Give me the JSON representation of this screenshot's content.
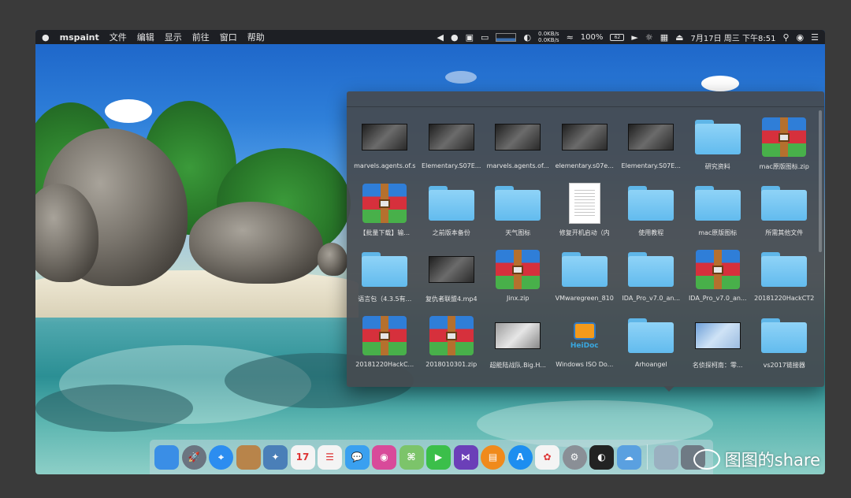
{
  "menubar": {
    "app_name": "mspaint",
    "menus": [
      "文件",
      "编辑",
      "显示",
      "前往",
      "窗口",
      "帮助"
    ],
    "net_up": "0.0KB/s",
    "net_down": "0.0KB/s",
    "battery_percent": "100%",
    "battery_icon_text": "62",
    "datetime": "7月17日 周三 下午8:51",
    "status_icons": [
      "back-icon",
      "qq-icon",
      "screenshot-icon",
      "cast-icon",
      "cpu-graph-icon",
      "moon-icon",
      "wifi-icon",
      "battery-icon",
      "volume-icon",
      "brightness-icon",
      "input-method-icon",
      "eject-icon",
      "search-icon",
      "siri-icon",
      "notification-center-icon"
    ]
  },
  "stack": {
    "items": [
      {
        "label": "marvels.agents.of.s",
        "kind": "video"
      },
      {
        "label": "Elementary.S07E...",
        "kind": "video"
      },
      {
        "label": "marvels.agents.of...",
        "kind": "video"
      },
      {
        "label": "elementary.s07e...",
        "kind": "video"
      },
      {
        "label": "Elementary.S07E...",
        "kind": "video"
      },
      {
        "label": "研究资料",
        "kind": "folder"
      },
      {
        "label": "mac原版图标.zip",
        "kind": "rar"
      },
      {
        "label": "【批量下载】输...",
        "kind": "rar"
      },
      {
        "label": "之前版本备份",
        "kind": "folder"
      },
      {
        "label": "天气图标",
        "kind": "folder"
      },
      {
        "label": "修复开机启动（内",
        "kind": "doc"
      },
      {
        "label": "使用教程",
        "kind": "folder"
      },
      {
        "label": "mac原版图标",
        "kind": "folder"
      },
      {
        "label": "所需其他文件",
        "kind": "folder"
      },
      {
        "label": "语言包（4.3.5有...",
        "kind": "folder"
      },
      {
        "label": "复仇者联盟4.mp4",
        "kind": "video"
      },
      {
        "label": "Jinx.zip",
        "kind": "rar"
      },
      {
        "label": "VMwaregreen_810",
        "kind": "folder"
      },
      {
        "label": "IDA_Pro_v7.0_an...",
        "kind": "folder"
      },
      {
        "label": "IDA_Pro_v7.0_an...",
        "kind": "rar"
      },
      {
        "label": "20181220HackCT2",
        "kind": "folder"
      },
      {
        "label": "20181220HackC...",
        "kind": "rar"
      },
      {
        "label": "2018010301.zip",
        "kind": "rar"
      },
      {
        "label": "超能陆战队.Big.H...",
        "kind": "video-light"
      },
      {
        "label": "Windows ISO Do...",
        "kind": "heidoc"
      },
      {
        "label": "Arhoangel",
        "kind": "folder"
      },
      {
        "label": "名侦探柯南：零...",
        "kind": "video-sky"
      },
      {
        "label": "vs2017链接器",
        "kind": "folder"
      }
    ],
    "heidoc_text": "HeiDoc"
  },
  "dock": {
    "apps": [
      {
        "name": "finder-icon",
        "color": "#3a8ee6",
        "glyph": ""
      },
      {
        "name": "launchpad-icon",
        "color": "#6b7480",
        "glyph": "🚀"
      },
      {
        "name": "safari-icon",
        "color": "#2c8df0",
        "glyph": "⌖"
      },
      {
        "name": "notes-book-icon",
        "color": "#b8844a",
        "glyph": ""
      },
      {
        "name": "preview-icon",
        "color": "#4a7fb8",
        "glyph": "✦"
      },
      {
        "name": "calendar-icon",
        "color": "#f4f4f4",
        "glyph": "17"
      },
      {
        "name": "reminders-icon",
        "color": "#f4f4f4",
        "glyph": "☰"
      },
      {
        "name": "messages-icon",
        "color": "#3aa0f0",
        "glyph": "💬"
      },
      {
        "name": "photo-booth-icon",
        "color": "#d84a9a",
        "glyph": "◉"
      },
      {
        "name": "maps-icon",
        "color": "#7cc46a",
        "glyph": "⌘"
      },
      {
        "name": "facetime-icon",
        "color": "#3bbf4a",
        "glyph": "▶"
      },
      {
        "name": "visual-studio-icon",
        "color": "#6b3fb8",
        "glyph": "⋈"
      },
      {
        "name": "books-icon",
        "color": "#f08a1c",
        "glyph": "▤"
      },
      {
        "name": "app-store-icon",
        "color": "#1d8ef0",
        "glyph": "A"
      },
      {
        "name": "photos-icon",
        "color": "#f4f4f4",
        "glyph": "✿"
      },
      {
        "name": "system-preferences-icon",
        "color": "#8a8f96",
        "glyph": "⚙"
      },
      {
        "name": "qq-dock-icon",
        "color": "#222",
        "glyph": "◐"
      },
      {
        "name": "weather-icon",
        "color": "#5aa0e0",
        "glyph": "☁"
      }
    ],
    "stack_icons": [
      {
        "name": "downloads-stack-icon",
        "color": "#9ab0c0"
      },
      {
        "name": "trash-icon",
        "color": "#6f7a84"
      }
    ]
  },
  "watermark": {
    "text": "图图的share"
  }
}
